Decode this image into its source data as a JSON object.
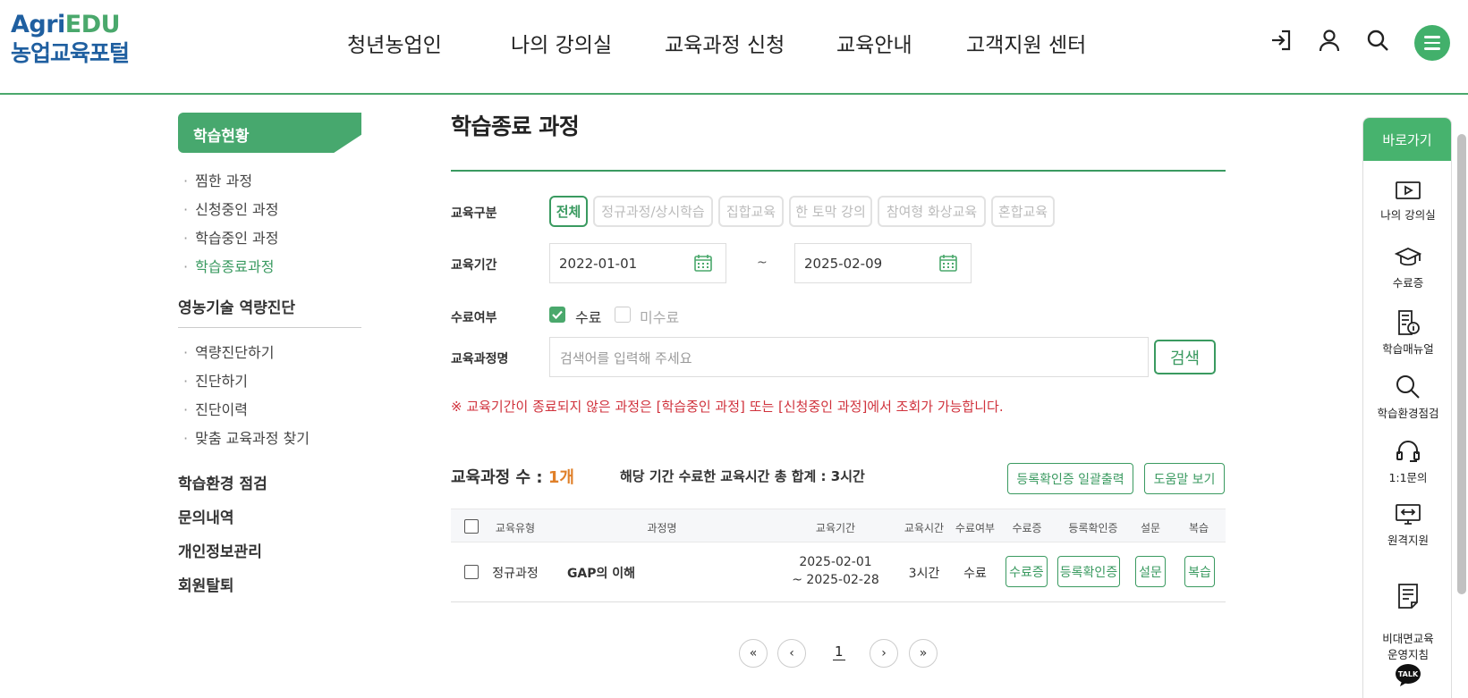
{
  "logo": {
    "agri": "Agri",
    "edu": "EDU",
    "sub": "농업교육포털"
  },
  "gnb": [
    "청년농업인",
    "나의 강의실",
    "교육과정 신청",
    "교육안내",
    "고객지원 센터"
  ],
  "utility_icons": [
    "login-icon",
    "user-icon",
    "search-icon",
    "menu-icon"
  ],
  "sidebar": {
    "head": "학습현황",
    "learning": [
      "찜한 과정",
      "신청중인 과정",
      "학습중인 과정",
      "학습종료과정"
    ],
    "active": "학습종료과정",
    "diagnosis_title": "영농기술 역량진단",
    "diagnosis": [
      "역량진단하기",
      "진단하기",
      "진단이력",
      "맞춤 교육과정 찾기"
    ],
    "env_check": "학습환경 점검",
    "inquiry": "문의내역",
    "privacy": "개인정보관리",
    "withdraw": "회원탈퇴"
  },
  "page_title": "학습종료 과정",
  "filter": {
    "type_label": "교육구분",
    "types": [
      "전체",
      "정규과정/상시학습",
      "집합교육",
      "한 토막 강의",
      "참여형 화상교육",
      "혼합교육"
    ],
    "selected_type": "전체",
    "period_label": "교육기간",
    "start_date": "2022-01-01",
    "tilde": "~",
    "end_date": "2025-02-09",
    "completion_label": "수료여부",
    "completed": "수료",
    "not_completed": "미수료",
    "name_label": "교육과정명",
    "search_placeholder": "검색어를 입력해 주세요",
    "search_button": "검색"
  },
  "notice": "※ 교육기간이 종료되지 않은 과정은 [학습중인 과정] 또는 [신청중인 과정]에서 조회가 가능합니다.",
  "summary": {
    "count_label": "교육과정 수 : ",
    "count_value": "1개",
    "total_hours": "해당 기간 수료한 교육시간 총 합계 : 3시간",
    "bulk_print": "등록확인증 일괄출력",
    "help": "도움말 보기"
  },
  "table": {
    "headers": [
      "교육유형",
      "과정명",
      "교육기간",
      "교육시간",
      "수료여부",
      "수료증",
      "등록확인증",
      "설문",
      "복습"
    ],
    "rows": [
      {
        "type": "정규과정",
        "name": "GAP의 이해",
        "period_start": "2025-02-01",
        "period_end": "~ 2025-02-28",
        "hours": "3시간",
        "status": "수료",
        "certificate": "수료증",
        "registration": "등록확인증",
        "survey": "설문",
        "review": "복습"
      }
    ]
  },
  "pagination": {
    "first": "«",
    "prev": "‹",
    "current": "1",
    "next": "›",
    "last": "»"
  },
  "quick_menu": {
    "title": "바로가기",
    "items": [
      "나의 강의실",
      "수료증",
      "학습매뉴얼",
      "학습환경점검",
      "1:1문의",
      "원격지원",
      "비대면교육\n운영지침",
      "TALK"
    ]
  },
  "colors": {
    "brand_green": "#4aa86c",
    "brand_blue": "#1f5fa0",
    "accent_orange": "#e0802a",
    "notice_red": "#d0323c"
  }
}
